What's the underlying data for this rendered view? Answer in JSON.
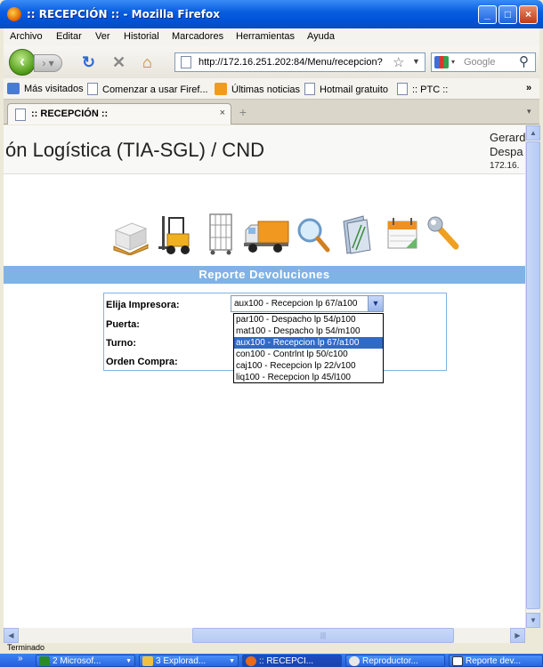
{
  "window": {
    "title": ":: RECEPCIÓN :: - Mozilla Firefox",
    "minimize": "_",
    "maximize": "□",
    "close": "×"
  },
  "menu": [
    "Archivo",
    "Editar",
    "Ver",
    "Historial",
    "Marcadores",
    "Herramientas",
    "Ayuda"
  ],
  "nav": {
    "url": "http://172.16.251.202:84/Menu/recepcion?",
    "search_placeholder": "Google"
  },
  "bookmarks": {
    "most_visited": "Más visitados",
    "start": "Comenzar a usar Firef...",
    "news": "Últimas noticias",
    "hotmail": "Hotmail gratuito",
    "ptc": ":: PTC ::",
    "more": "»"
  },
  "tab": {
    "label": ":: RECEPCIÓN ::",
    "close": "×",
    "new": "+"
  },
  "header": {
    "title": "ón Logística (TIA-SGL) / CND",
    "user1": "Gerardo",
    "user2": "Despa",
    "ip": "172.16."
  },
  "icons": [
    "pallet-icon",
    "forklift-icon",
    "cage-cart-icon",
    "truck-icon",
    "magnifier-icon",
    "folders-icon",
    "calendar-icon",
    "wrench-icon"
  ],
  "section_title": "Reporte Devoluciones",
  "form": {
    "printer_label": "Elija Impresora:",
    "door_label": "Puerta:",
    "shift_label": "Turno:",
    "po_label": "Orden Compra:",
    "printer_selected": "aux100 - Recepcion lp 67/a100"
  },
  "dropdown_options": [
    "par100 - Despacho lp 54/p100",
    "mat100 - Despacho lp 54/m100",
    "aux100 - Recepcion lp 67/a100",
    "con100 - Contrlnt lp 50/c100",
    "caj100 - Recepcion lp 22/v100",
    "liq100 - Recepcion lp 45/l100"
  ],
  "dropdown_selected_index": 2,
  "status": "Terminado",
  "taskbar": [
    {
      "label": "2 Microsof..."
    },
    {
      "label": "3 Explorad..."
    },
    {
      "label": ":: RECEPCI..."
    },
    {
      "label": "Reproductor..."
    },
    {
      "label": "Reporte dev..."
    }
  ],
  "colors": {
    "section_bar": "#7fb3e6",
    "selected_option": "#316ac5",
    "titlebar": "#0a5fe0"
  }
}
